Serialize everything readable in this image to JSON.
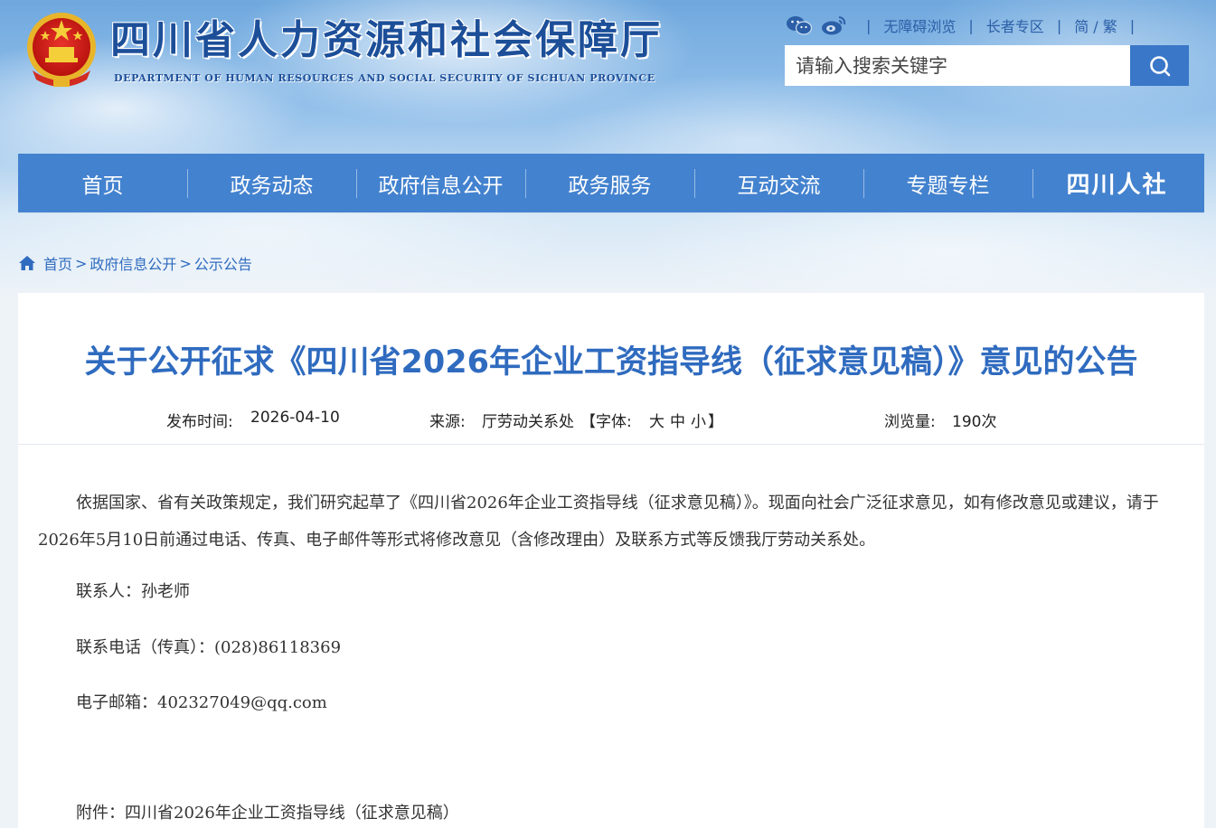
{
  "header": {
    "site_title": "四川省人力资源和社会保障厅",
    "site_subtitle": "DEPARTMENT OF HUMAN RESOURCES AND SOCIAL SECURITY OF SICHUAN PROVINCE",
    "top_links": {
      "accessibility": "无障碍浏览",
      "elderly": "长者专区",
      "lang": "简 / 繁"
    },
    "search": {
      "placeholder": "请输入搜索关键字"
    }
  },
  "nav": {
    "items": [
      "首页",
      "政务动态",
      "政府信息公开",
      "政务服务",
      "互动交流",
      "专题专栏"
    ],
    "brand": "四川人社"
  },
  "breadcrumb": {
    "items": [
      "首页",
      "政府信息公开",
      "公示公告"
    ],
    "separator": ">"
  },
  "article": {
    "title": "关于公开征求《四川省2026年企业工资指导线（征求意见稿）》意见的公告",
    "meta": {
      "publish_label": "发布时间:",
      "publish_date": "2026-04-10",
      "source_label": "来源:",
      "source": "厅劳动关系处",
      "font_label": "【字体:",
      "font_large": "大",
      "font_medium": "中",
      "font_small": "小",
      "font_close": "】",
      "views_label": "浏览量:",
      "views": "190次"
    },
    "paragraph": "依据国家、省有关政策规定，我们研究起草了《四川省2026年企业工资指导线（征求意见稿）》。现面向社会广泛征求意见，如有修改意见或建议，请于2026年5月10日前通过电话、传真、电子邮件等形式将修改意见（含修改理由）及联系方式等反馈我厅劳动关系处。",
    "contact_person": "联系人：孙老师",
    "contact_phone": "联系电话（传真）：(028)86118369",
    "contact_email": "电子邮箱：402327049@qq.com",
    "attachment_label": "附件：",
    "attachment_name": "四川省2026年企业工资指导线（征求意见稿）"
  },
  "colors": {
    "nav_bg": "#4382cf",
    "title_blue": "#2f6bbf",
    "site_title_blue": "#1d4f99",
    "search_button": "#3a77c8"
  },
  "icons": [
    "national-emblem-icon",
    "wechat-icon",
    "weibo-icon",
    "search-icon",
    "home-icon"
  ]
}
